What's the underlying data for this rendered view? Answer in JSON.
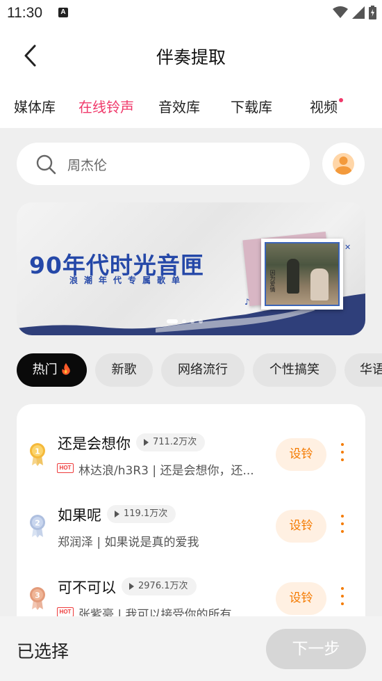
{
  "status_bar": {
    "time": "11:30",
    "notification_icon": "A"
  },
  "header": {
    "title": "伴奏提取"
  },
  "tabs": [
    {
      "label": "媒体库",
      "active": false
    },
    {
      "label": "在线铃声",
      "active": true
    },
    {
      "label": "音效库",
      "active": false
    },
    {
      "label": "下载库",
      "active": false
    },
    {
      "label": "视频",
      "active": false,
      "dot": true
    }
  ],
  "search": {
    "placeholder": "周杰伦"
  },
  "banner": {
    "title": "90年代时光音匣",
    "subtitle": "浪潮年代专属歌单",
    "album_text": "因为爱情"
  },
  "chips": [
    {
      "label": "热门",
      "active": true,
      "icon": "fire-icon"
    },
    {
      "label": "新歌",
      "active": false
    },
    {
      "label": "网络流行",
      "active": false
    },
    {
      "label": "个性搞笑",
      "active": false
    },
    {
      "label": "华语",
      "active": false
    }
  ],
  "songs": [
    {
      "rank": "1",
      "title": "还是会想你",
      "plays": "711.2万次",
      "hot": true,
      "description": "林达浪/h3R3 | 还是会想你，还...",
      "action": "设铃"
    },
    {
      "rank": "2",
      "title": "如果呢",
      "plays": "119.1万次",
      "hot": false,
      "description": "郑润泽 | 如果说是真的爱我",
      "action": "设铃"
    },
    {
      "rank": "3",
      "title": "可不可以",
      "plays": "2976.1万次",
      "hot": true,
      "description": "张紫豪 | 我可以接受你的所有...",
      "action": "设铃"
    }
  ],
  "hot_badge": "HOT",
  "bottom": {
    "selected_label": "已选择",
    "next_label": "下一步"
  },
  "colors": {
    "accent": "#f0386a",
    "action_orange": "#f47a00",
    "banner_blue": "#2548a8"
  }
}
